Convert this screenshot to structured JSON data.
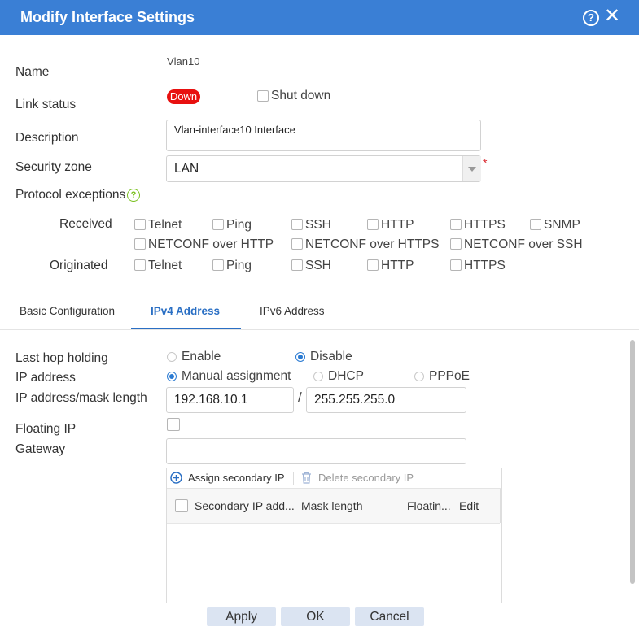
{
  "dialog": {
    "title": "Modify Interface Settings",
    "help_icon": "?",
    "close_icon": "✕"
  },
  "fields": {
    "name_label": "Name",
    "name_value": "Vlan10",
    "link_status_label": "Link status",
    "link_status_value": "Down",
    "shutdown_label": "Shut down",
    "description_label": "Description",
    "description_value": "Vlan-interface10 Interface",
    "security_zone_label": "Security zone",
    "security_zone_value": "LAN",
    "required_mark": "*",
    "protocol_exceptions_label": "Protocol exceptions",
    "protocol_help": "?"
  },
  "protocols": {
    "received_label": "Received",
    "received_row1": [
      "Telnet",
      "Ping",
      "SSH",
      "HTTP",
      "HTTPS",
      "SNMP"
    ],
    "received_row2": [
      "NETCONF over HTTP",
      "NETCONF over HTTPS",
      "NETCONF over SSH"
    ],
    "originated_label": "Originated",
    "originated": [
      "Telnet",
      "Ping",
      "SSH",
      "HTTP",
      "HTTPS"
    ]
  },
  "tabs": [
    "Basic Configuration",
    "IPv4 Address",
    "IPv6 Address"
  ],
  "ipv4": {
    "last_hop_label": "Last hop holding",
    "enable": "Enable",
    "disable": "Disable",
    "ip_address_label": "IP address",
    "manual": "Manual assignment",
    "dhcp": "DHCP",
    "pppoe": "PPPoE",
    "ipmask_label": "IP address/mask length",
    "ip_value": "192.168.10.1",
    "slash": "/",
    "mask_value": "255.255.255.0",
    "floating_label": "Floating IP",
    "gateway_label": "Gateway",
    "gateway_value": "",
    "assign_secondary": "Assign secondary IP",
    "delete_secondary": "Delete secondary IP",
    "table_headers": [
      "Secondary IP add...",
      "Mask length",
      "Floatin...",
      "Edit"
    ]
  },
  "buttons": {
    "apply": "Apply",
    "ok": "OK",
    "cancel": "Cancel"
  },
  "colors": {
    "title_bar": "#3a7fd5",
    "active_tab": "#2a6fc4",
    "badge": "#e8100f",
    "help_green": "#79c01e"
  }
}
